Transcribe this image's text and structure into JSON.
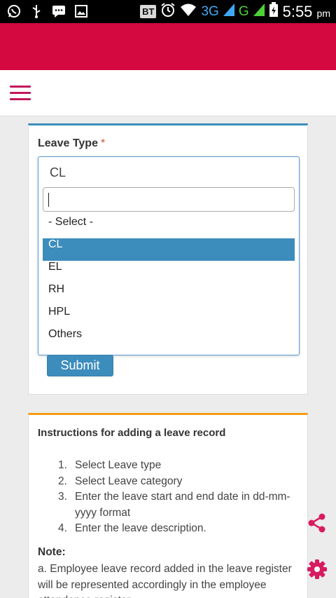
{
  "status_bar": {
    "bt_label": "BT",
    "net_3g": "3G",
    "net_g": "G",
    "time": "5:55",
    "ampm": "pm"
  },
  "form": {
    "field_label": "Leave Type",
    "required_mark": "*",
    "selected_value": "CL",
    "search_value": "",
    "options": [
      "- Select -",
      "CL",
      "EL",
      "RH",
      "HPL",
      "Others"
    ],
    "highlighted_option": "CL",
    "submit_label": "Submit"
  },
  "instructions": {
    "title": "Instructions for adding a leave record",
    "steps": [
      {
        "num": "1.",
        "text": "Select Leave type"
      },
      {
        "num": "2.",
        "text": "Select Leave category"
      },
      {
        "num": "3.",
        "text": "Enter the leave start and end date in dd-mm-yyyy format"
      },
      {
        "num": "4.",
        "text": "Enter the leave description."
      }
    ],
    "note_title": "Note:",
    "note_text": "a. Employee leave record added in the leave register will be represented accordingly in the employee attendance register."
  },
  "colors": {
    "brand": "#d3093f",
    "accent": "#c2185b",
    "primary": "#3c8dbc",
    "warning": "#f39c12"
  },
  "icons": {
    "menu": "hamburger-menu-icon",
    "share": "share-icon",
    "settings": "gear-icon"
  }
}
